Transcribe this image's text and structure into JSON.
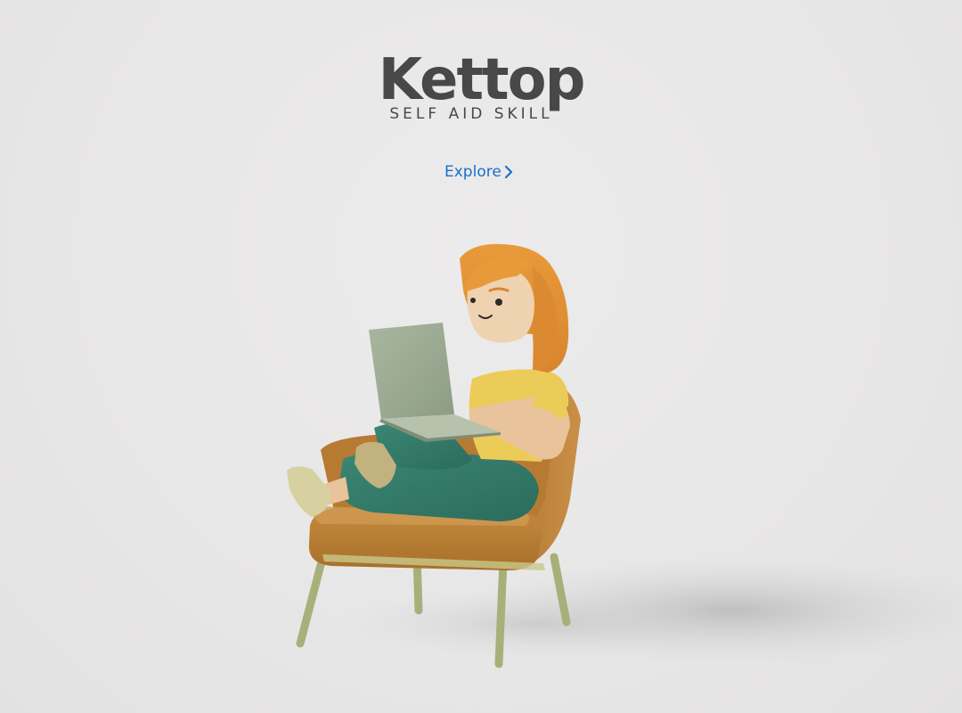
{
  "brand": {
    "title": "Kettop",
    "tagline": "SELF AID SKILL"
  },
  "cta": {
    "label": "Explore",
    "icon": "chevron-right-icon",
    "color": "#1a6fc9"
  },
  "colors": {
    "background": "#e9e8e8",
    "text": "#484848"
  },
  "hero": {
    "description_icon": "woman-on-armchair-with-laptop-illustration"
  }
}
